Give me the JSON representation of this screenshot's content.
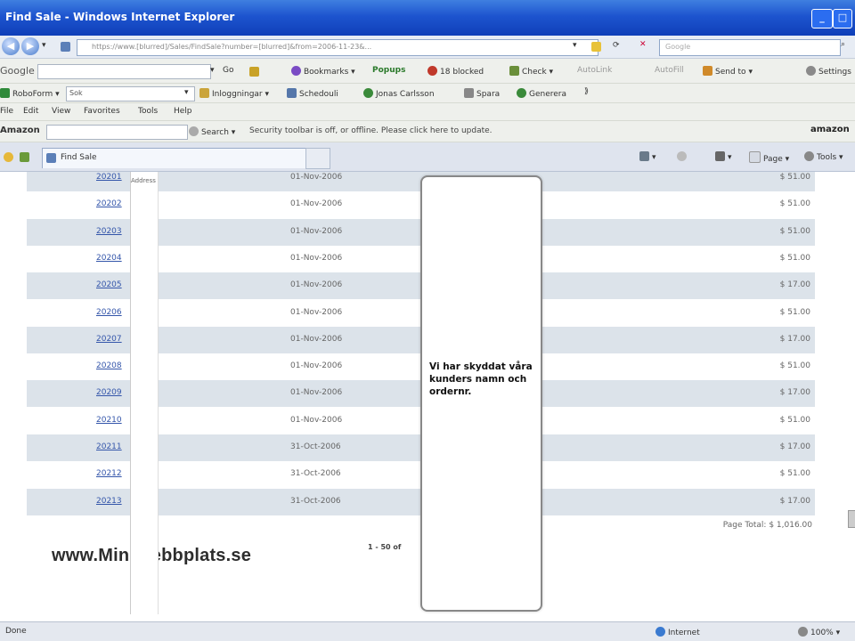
{
  "window": {
    "title": "Find Sale - Windows Internet Explorer"
  },
  "address": {
    "url": "https://www.[blurred]/Sales/FindSale?number=[blurred]&from=2006-11-23&...",
    "search_placeholder": "Google"
  },
  "toolbar_google": {
    "brand": "Google",
    "go_label": "Go",
    "bookmarks": "Bookmarks",
    "popups": "Popups",
    "blocked": "18 blocked",
    "check": "Check",
    "autolink": "AutoLink",
    "autofill": "AutoFill",
    "send_to": "Send to",
    "settings": "Settings"
  },
  "toolbar_links": {
    "foldername": "RoboForm",
    "search_value": "Sok",
    "links": [
      "Inloggningar",
      "Schedouli",
      "Jonas Carlsson",
      "Spara",
      "Generera"
    ]
  },
  "menu": [
    "File",
    "Edit",
    "View",
    "Favorites",
    "Tools",
    "Help"
  ],
  "toolbar_amazon": {
    "label": "Amazon",
    "search_button": "Search",
    "status_text": "Security toolbar is off, or offline. Please click here to update.",
    "brand": "amazon"
  },
  "tab": {
    "label": "Find Sale"
  },
  "command_bar": {
    "page": "Page",
    "tools": "Tools"
  },
  "table": {
    "column_header": "Address",
    "rows": [
      {
        "id": "20201",
        "date": "01-Nov-2006",
        "amount": "$ 51.00"
      },
      {
        "id": "20202",
        "date": "01-Nov-2006",
        "amount": "$ 51.00"
      },
      {
        "id": "20203",
        "date": "01-Nov-2006",
        "amount": "$ 51.00"
      },
      {
        "id": "20204",
        "date": "01-Nov-2006",
        "amount": "$ 51.00"
      },
      {
        "id": "20205",
        "date": "01-Nov-2006",
        "amount": "$ 17.00"
      },
      {
        "id": "20206",
        "date": "01-Nov-2006",
        "amount": "$ 51.00"
      },
      {
        "id": "20207",
        "date": "01-Nov-2006",
        "amount": "$ 17.00"
      },
      {
        "id": "20208",
        "date": "01-Nov-2006",
        "amount": "$ 51.00"
      },
      {
        "id": "20209",
        "date": "01-Nov-2006",
        "amount": "$ 17.00"
      },
      {
        "id": "20210",
        "date": "01-Nov-2006",
        "amount": "$ 51.00"
      },
      {
        "id": "20211",
        "date": "31-Oct-2006",
        "amount": "$ 17.00"
      },
      {
        "id": "20212",
        "date": "31-Oct-2006",
        "amount": "$ 51.00"
      },
      {
        "id": "20213",
        "date": "31-Oct-2006",
        "amount": "$ 17.00"
      }
    ],
    "page_total": "Page Total: $ 1,016.00",
    "pager": "1 - 50 of"
  },
  "privacy_overlay": {
    "message": "Vi har skyddat våra kunders namn och ordernr."
  },
  "watermark": "www.MiniWebbplats.se",
  "status": {
    "left": "Done",
    "zone": "Internet",
    "zoom": "100%"
  },
  "colors": {
    "titlebar": "#1d54cf",
    "row_shade": "#dce3ea",
    "link": "#3355aa"
  }
}
